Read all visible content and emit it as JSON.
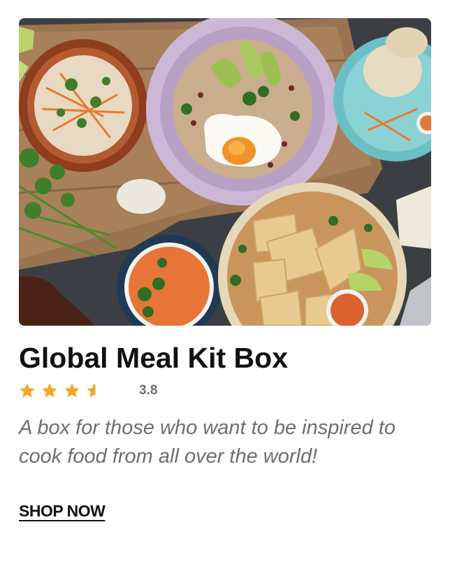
{
  "product": {
    "title": "Global Meal Kit Box",
    "rating": {
      "value_text": "3.8",
      "value": 3.8,
      "max": 5,
      "star_color": "#F5A623"
    },
    "description": "A box for those who want to be inspired to cook food from all over the world!",
    "cta_label": "SHOP NOW"
  },
  "image": {
    "name": "meal-kit-food-photo"
  },
  "icons": {
    "star": "star-icon"
  }
}
